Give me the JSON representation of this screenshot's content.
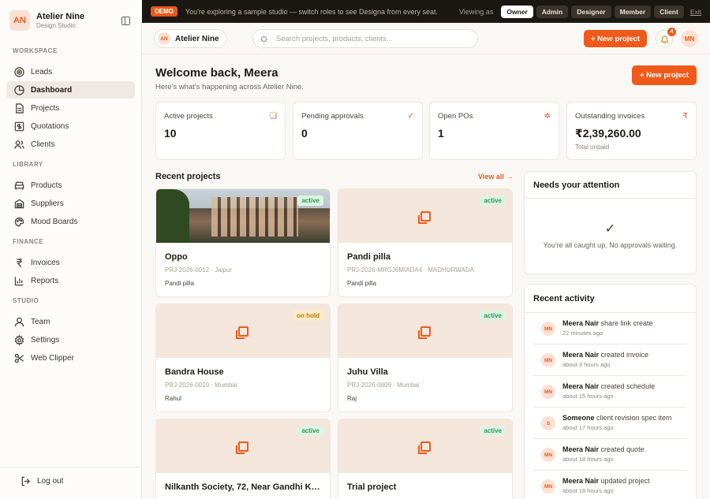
{
  "brand": {
    "initials": "AN",
    "name": "Atelier Nine",
    "subtitle": "Design Studio"
  },
  "sidebar": {
    "workspace_label": "WORKSPACE",
    "library_label": "LIBRARY",
    "finance_label": "FINANCE",
    "studio_label": "STUDIO",
    "items": {
      "leads": "Leads",
      "dashboard": "Dashboard",
      "projects": "Projects",
      "quotations": "Quotations",
      "clients": "Clients",
      "products": "Products",
      "suppliers": "Suppliers",
      "mood_boards": "Mood Boards",
      "invoices": "Invoices",
      "reports": "Reports",
      "team": "Team",
      "settings": "Settings",
      "web_clipper": "Web Clipper"
    },
    "logout": "Log out"
  },
  "demo": {
    "badge": "DEMO",
    "message": "You're exploring a sample studio — switch roles to see Designa from every seat.",
    "viewing_as": "Viewing as",
    "roles": [
      "Owner",
      "Admin",
      "Designer",
      "Member",
      "Client"
    ],
    "selected_role": "Owner",
    "exit": "Exit"
  },
  "topbar": {
    "studio_initials": "AN",
    "studio_name": "Atelier Nine",
    "search_placeholder": "Search projects, products, clients...",
    "new_project": "+ New project",
    "notifications": "4",
    "user_initials": "MN"
  },
  "main": {
    "welcome": "Welcome back, Meera",
    "subtitle": "Here's what's happening across Atelier Nine.",
    "new_project": "+ New project"
  },
  "stats": [
    {
      "label": "Active projects",
      "value": "10",
      "icon": "box-icon",
      "glyph": "❏"
    },
    {
      "label": "Pending approvals",
      "value": "0",
      "icon": "check-icon",
      "glyph": "✓"
    },
    {
      "label": "Open POs",
      "value": "1",
      "icon": "gear-icon",
      "glyph": "✲"
    },
    {
      "label": "Outstanding invoices",
      "value": "₹2,39,260.00",
      "sub": "Total unpaid",
      "icon": "rupee-icon",
      "glyph": "₹"
    }
  ],
  "recent": {
    "title": "Recent projects",
    "view_all": "View all →",
    "projects": [
      {
        "name": "Oppo",
        "code": "PRJ-2026-0012",
        "city": "· Jaipur",
        "client": "Pandi pilla",
        "status": "active"
      },
      {
        "name": "Pandi pilla",
        "code": "PRJ-2026-MRGJ6MIADA4",
        "city": "· MADHURWADA",
        "client": "Pandi pilla",
        "status": "active"
      },
      {
        "name": "Bandra House",
        "code": "PRJ-2026-0010",
        "city": "· Mumbai",
        "client": "Rahul",
        "status": "on hold"
      },
      {
        "name": "Juhu Villa",
        "code": "PRJ-2026-0009",
        "city": "· Mumbai",
        "client": "Raj",
        "status": "active"
      },
      {
        "name": "Nilkanth Society, 72, Near Gandhi Ku...",
        "code": "",
        "city": "",
        "client": "",
        "status": "active"
      },
      {
        "name": "Trial project",
        "code": "",
        "city": "",
        "client": "",
        "status": "active"
      }
    ]
  },
  "attention": {
    "title": "Needs your attention",
    "check": "✓",
    "message": "You're all caught up. No approvals waiting."
  },
  "activity": {
    "title": "Recent activity",
    "items": [
      {
        "initials": "MN",
        "who": "Meera Nair",
        "what": " share link create",
        "when": "22 minutes ago"
      },
      {
        "initials": "MN",
        "who": "Meera Nair",
        "what": " created invoice",
        "when": "about 3 hours ago"
      },
      {
        "initials": "MN",
        "who": "Meera Nair",
        "what": " created schedule",
        "when": "about 15 hours ago"
      },
      {
        "initials": "S",
        "who": "Someone",
        "what": " client revision spec item",
        "when": "about 17 hours ago"
      },
      {
        "initials": "MN",
        "who": "Meera Nair",
        "what": " created quote",
        "when": "about 18 hours ago"
      },
      {
        "initials": "MN",
        "who": "Meera Nair",
        "what": " updated project",
        "when": "about 18 hours ago"
      }
    ]
  }
}
